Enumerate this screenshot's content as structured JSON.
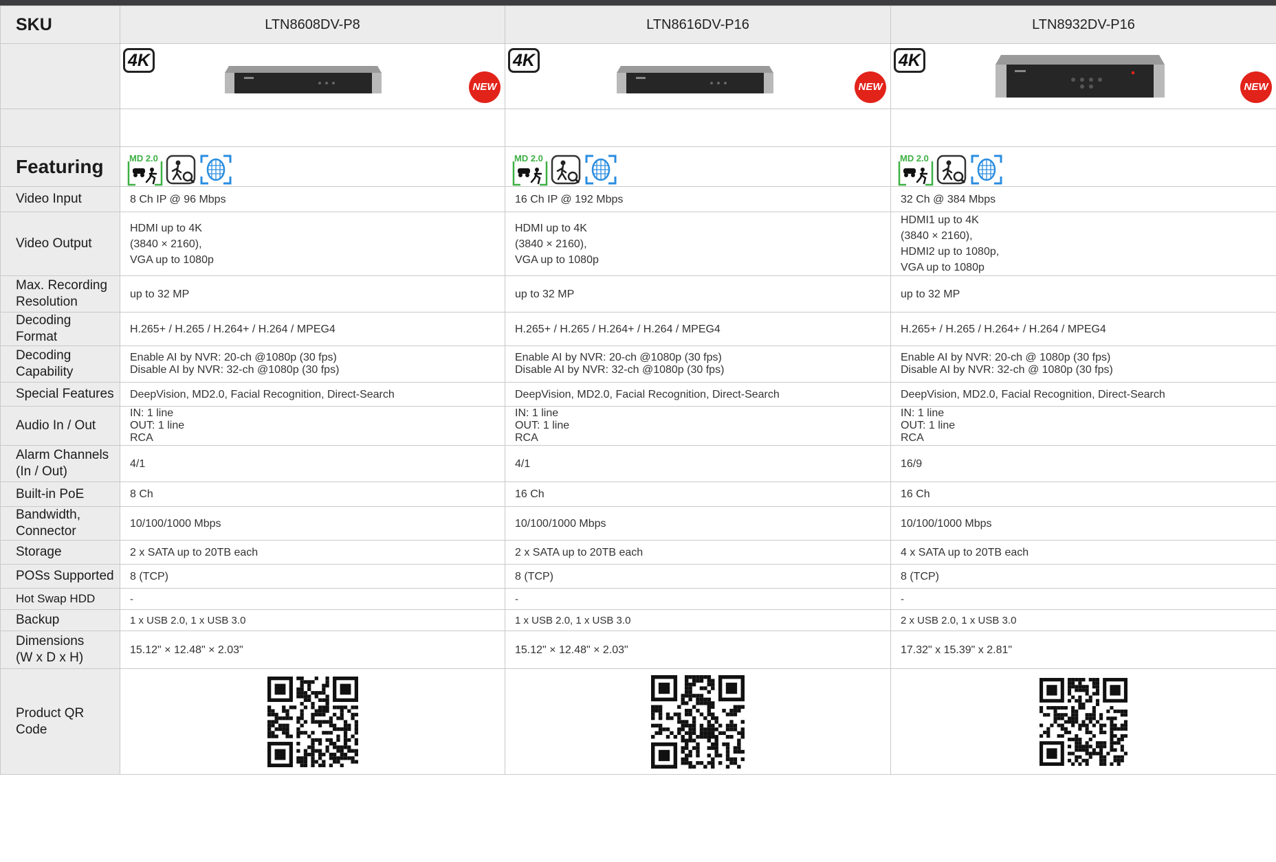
{
  "header": {
    "sku_label": "SKU",
    "skus": [
      "LTN8608DV-P8",
      "LTN8616DV-P16",
      "LTN8932DV-P16"
    ]
  },
  "badges": {
    "uhd": "4K",
    "new": "NEW"
  },
  "featuring": {
    "label": "Featuring",
    "md_badge": "MD 2.0"
  },
  "rows": {
    "video_input": {
      "label": "Video Input",
      "values": [
        "8 Ch IP @ 96 Mbps",
        "16 Ch IP @ 192 Mbps",
        "32 Ch @ 384 Mbps"
      ]
    },
    "video_output": {
      "label": "Video Output",
      "values": [
        [
          "HDMI up to 4K",
          "(3840 × 2160),",
          "VGA up to 1080p"
        ],
        [
          "HDMI up to 4K",
          "(3840 × 2160),",
          "VGA up to 1080p"
        ],
        [
          "HDMI1 up to 4K",
          "(3840 × 2160),",
          "HDMI2 up to 1080p,",
          "VGA up to 1080p"
        ]
      ]
    },
    "max_recording": {
      "label": [
        "Max. Recording",
        "Resolution"
      ],
      "values": [
        "up to 32 MP",
        "up to 32 MP",
        "up to 32 MP"
      ]
    },
    "decoding_format": {
      "label": "Decoding Format",
      "values": [
        "H.265+ / H.265 / H.264+ / H.264 / MPEG4",
        "H.265+ / H.265 / H.264+ / H.264 / MPEG4",
        "H.265+ / H.265 / H.264+ / H.264 / MPEG4"
      ]
    },
    "decoding_capability": {
      "label": [
        "Decoding",
        "Capability"
      ],
      "values": [
        [
          "Enable AI by NVR: 20-ch @1080p (30 fps)",
          "Disable AI by NVR: 32-ch @1080p (30 fps)"
        ],
        [
          "Enable AI by NVR: 20-ch @1080p (30 fps)",
          "Disable AI by NVR: 32-ch @1080p (30 fps)"
        ],
        [
          "Enable AI by NVR: 20-ch @ 1080p (30 fps)",
          "Disable AI by NVR: 32-ch @ 1080p (30 fps)"
        ]
      ]
    },
    "special_features": {
      "label": "Special Features",
      "values": [
        "DeepVision, MD2.0, Facial Recognition, Direct-Search",
        "DeepVision, MD2.0, Facial Recognition, Direct-Search",
        "DeepVision, MD2.0, Facial Recognition, Direct-Search"
      ]
    },
    "audio": {
      "label": "Audio In / Out",
      "values": [
        [
          "IN: 1 line",
          "OUT: 1 line",
          "RCA"
        ],
        [
          "IN: 1 line",
          "OUT: 1 line",
          "RCA"
        ],
        [
          "IN: 1 line",
          "OUT: 1 line",
          "RCA"
        ]
      ]
    },
    "alarm": {
      "label": [
        "Alarm Channels",
        "(In / Out)"
      ],
      "values": [
        "4/1",
        "4/1",
        "16/9"
      ]
    },
    "poe": {
      "label": "Built-in PoE",
      "values": [
        "8 Ch",
        "16 Ch",
        "16 Ch"
      ]
    },
    "bandwidth": {
      "label": [
        "Bandwidth,",
        "Connector"
      ],
      "values": [
        "10/100/1000 Mbps",
        "10/100/1000 Mbps",
        "10/100/1000 Mbps"
      ]
    },
    "storage": {
      "label": "Storage",
      "values": [
        "2 x SATA up to 20TB each",
        "2 x SATA up to 20TB each",
        "4 x SATA up to 20TB each"
      ]
    },
    "pos": {
      "label": "POSs Supported",
      "values": [
        "8 (TCP)",
        "8 (TCP)",
        "8 (TCP)"
      ]
    },
    "hot_swap": {
      "label": "Hot Swap HDD",
      "values": [
        "-",
        "-",
        "-"
      ]
    },
    "backup": {
      "label": "Backup",
      "values": [
        "1 x USB 2.0, 1 x USB 3.0",
        "1 x USB 2.0, 1 x USB 3.0",
        "2 x USB 2.0, 1 x USB 3.0"
      ]
    },
    "dimensions": {
      "label": [
        "Dimensions",
        "(W x D x H)"
      ],
      "values": [
        "15.12\" × 12.48\" × 2.03\"",
        "15.12\" × 12.48\" × 2.03\"",
        "17.32\" x 15.39\" x 2.81\""
      ]
    },
    "qr": {
      "label": "Product QR Code"
    }
  },
  "colors": {
    "label_bg": "#ececec",
    "border": "#c9c9c9",
    "top_bar": "#3d3d3f",
    "new_badge": "#e2231a",
    "md_green": "#3cb043",
    "face_blue": "#2a8de0"
  }
}
